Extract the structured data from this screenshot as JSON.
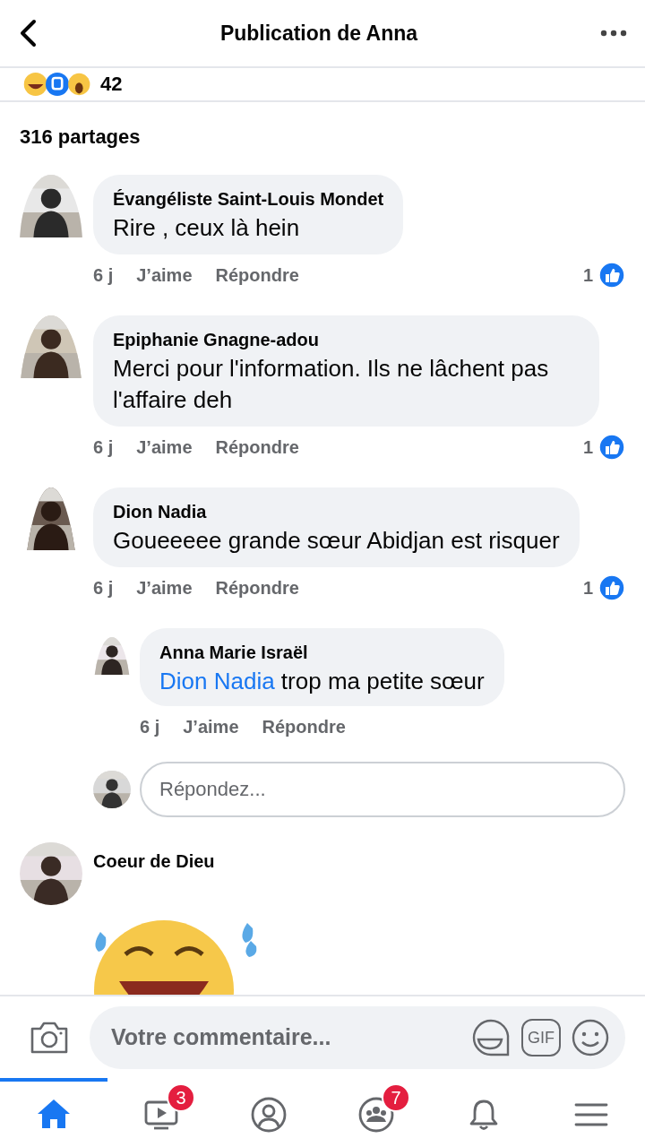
{
  "header": {
    "title": "Publication de Anna"
  },
  "reactions": {
    "count": "42"
  },
  "shares": "316 partages",
  "comments": [
    {
      "kind": "text",
      "author": "Évangéliste Saint-Louis Mondet",
      "text": "Rire , ceux là hein",
      "time": "6 j",
      "like": "J’aime",
      "reply": "Répondre",
      "likes": "1"
    },
    {
      "kind": "text",
      "author": "Epiphanie Gnagne-adou",
      "text": "Merci pour l'information.  Ils ne lâchent pas l'affaire deh",
      "time": "6 j",
      "like": "J’aime",
      "reply": "Répondre",
      "likes": "1"
    },
    {
      "kind": "text",
      "author": "Dion Nadia",
      "text": "Goueeeee grande sœur Abidjan est risquer",
      "time": "6 j",
      "like": "J’aime",
      "reply": "Répondre",
      "likes": "1",
      "replies": [
        {
          "author": "Anna Marie Israël",
          "mention": "Dion Nadia",
          "text": "trop ma petite sœur",
          "time": "6 j",
          "like": "J’aime",
          "reply": "Répondre"
        }
      ],
      "reply_box": {
        "placeholder": "Répondez..."
      }
    },
    {
      "kind": "sticker",
      "author": "Coeur de Dieu"
    }
  ],
  "composer": {
    "placeholder": "Votre commentaire...",
    "gif": "GIF"
  },
  "tabs": [
    {
      "kind": "home",
      "selected": true
    },
    {
      "kind": "video",
      "selected": false,
      "badge": "3"
    },
    {
      "kind": "profile",
      "selected": false
    },
    {
      "kind": "groups",
      "selected": false,
      "badge": "7"
    },
    {
      "kind": "bell",
      "selected": false
    },
    {
      "kind": "menu",
      "selected": false
    }
  ]
}
